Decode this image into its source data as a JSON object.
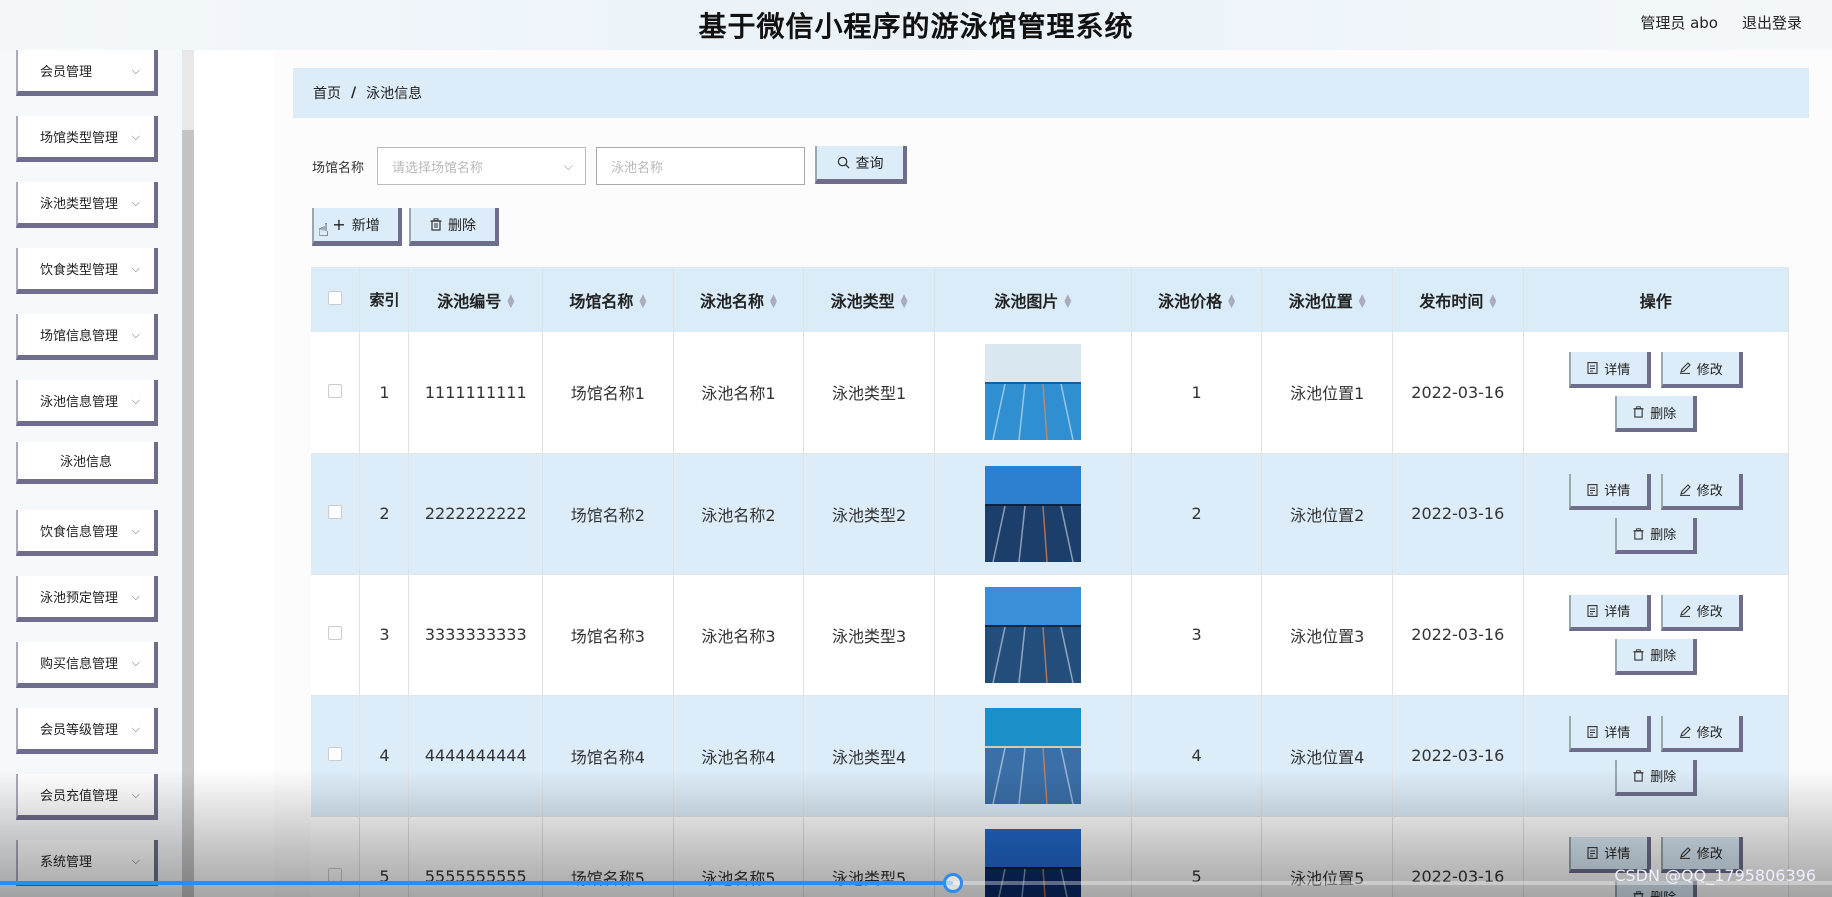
{
  "header": {
    "title": "基于微信小程序的游泳馆管理系统",
    "user_label": "管理员 abo",
    "logout_label": "退出登录"
  },
  "sidebar": {
    "items": [
      {
        "label": "会员管理"
      },
      {
        "label": "场馆类型管理"
      },
      {
        "label": "泳池类型管理"
      },
      {
        "label": "饮食类型管理"
      },
      {
        "label": "场馆信息管理"
      },
      {
        "label": "泳池信息管理"
      },
      {
        "label": "泳池信息",
        "submenu": true
      },
      {
        "label": "饮食信息管理"
      },
      {
        "label": "泳池预定管理"
      },
      {
        "label": "购买信息管理"
      },
      {
        "label": "会员等级管理"
      },
      {
        "label": "会员充值管理"
      },
      {
        "label": "系统管理"
      }
    ]
  },
  "breadcrumb": {
    "home": "首页",
    "separator": "/",
    "current": "泳池信息"
  },
  "search": {
    "label": "场馆名称",
    "select_placeholder": "请选择场馆名称",
    "input_placeholder": "泳池名称",
    "query_label": "查询"
  },
  "toolbar": {
    "add_label": "新增",
    "delete_label": "删除"
  },
  "table": {
    "headers": {
      "index": "索引",
      "code": "泳池编号",
      "venue": "场馆名称",
      "name": "泳池名称",
      "type": "泳池类型",
      "image": "泳池图片",
      "price": "泳池价格",
      "location": "泳池位置",
      "time": "发布时间",
      "actions": "操作"
    },
    "rows": [
      {
        "index": "1",
        "code": "1111111111",
        "venue": "场馆名称1",
        "name": "泳池名称1",
        "type": "泳池类型1",
        "price": "1",
        "location": "泳池位置1",
        "time": "2022-03-16"
      },
      {
        "index": "2",
        "code": "2222222222",
        "venue": "场馆名称2",
        "name": "泳池名称2",
        "type": "泳池类型2",
        "price": "2",
        "location": "泳池位置2",
        "time": "2022-03-16"
      },
      {
        "index": "3",
        "code": "3333333333",
        "venue": "场馆名称3",
        "name": "泳池名称3",
        "type": "泳池类型3",
        "price": "3",
        "location": "泳池位置3",
        "time": "2022-03-16"
      },
      {
        "index": "4",
        "code": "4444444444",
        "venue": "场馆名称4",
        "name": "泳池名称4",
        "type": "泳池类型4",
        "price": "4",
        "location": "泳池位置4",
        "time": "2022-03-16"
      },
      {
        "index": "5",
        "code": "5555555555",
        "venue": "场馆名称5",
        "name": "泳池名称5",
        "type": "泳池类型5",
        "price": "5",
        "location": "泳池位置5",
        "time": "2022-03-16"
      }
    ],
    "action_labels": {
      "detail": "详情",
      "edit": "修改",
      "delete": "删除"
    }
  },
  "video": {
    "progress": 0.52,
    "watermark": "CSDN @QQ_1795806396"
  },
  "colors": {
    "accent": "#dcecf8",
    "button_border": "#6e6e8c",
    "progress": "#2d8cf0"
  }
}
